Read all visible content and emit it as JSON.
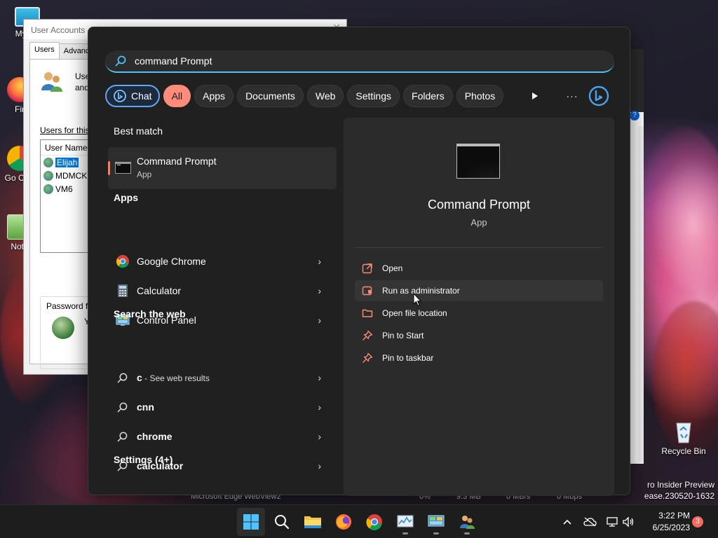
{
  "desktop": {
    "icons": [
      {
        "label": "My Co"
      },
      {
        "label": "Fir"
      },
      {
        "label": "Go Chr"
      },
      {
        "label": "Note"
      },
      {
        "label": "Recycle Bin"
      }
    ],
    "watermark_line1": "ro Insider Preview",
    "watermark_line2": "ease.230520-1632"
  },
  "user_accounts": {
    "title": "User Accounts",
    "tabs": [
      "Users",
      "Advanc"
    ],
    "desc_line1": "User",
    "desc_line2": "and",
    "users_for_label": "Users for this",
    "column_header": "User Name",
    "users": [
      "Elijah",
      "MDMCK",
      "VM6"
    ],
    "password_label": "Password fo",
    "password_text": "Y"
  },
  "background_window": {
    "help_label": "?",
    "strip": [
      "Microsoft Edge WebView2",
      "0%",
      "9.3 MB",
      "0 MB/s",
      "0 Mbps"
    ]
  },
  "search": {
    "query": "command Prompt",
    "filters": [
      "Chat",
      "All",
      "Apps",
      "Documents",
      "Web",
      "Settings",
      "Folders",
      "Photos"
    ],
    "active_filter": "All",
    "more_label": "···"
  },
  "results": {
    "best_match_heading": "Best match",
    "best_match": {
      "title": "Command Prompt",
      "subtitle": "App"
    },
    "apps_heading": "Apps",
    "apps": [
      {
        "label": "Google Chrome",
        "icon": "chrome-icon"
      },
      {
        "label": "Calculator",
        "icon": "calculator-icon"
      },
      {
        "label": "Control Panel",
        "icon": "control-panel-icon"
      }
    ],
    "web_heading": "Search the web",
    "web": [
      {
        "label_bold": "c",
        "label_rest": " - See web results"
      },
      {
        "label_bold": "cnn",
        "label_rest": ""
      },
      {
        "label_bold": "chrome",
        "label_rest": ""
      },
      {
        "label_bold": "calculator",
        "label_rest": ""
      }
    ],
    "settings_heading": "Settings (4+)"
  },
  "preview": {
    "title": "Command Prompt",
    "subtitle": "App",
    "actions": [
      {
        "label": "Open",
        "icon": "open-external-icon"
      },
      {
        "label": "Run as administrator",
        "icon": "admin-shield-icon"
      },
      {
        "label": "Open file location",
        "icon": "folder-icon"
      },
      {
        "label": "Pin to Start",
        "icon": "pin-icon"
      },
      {
        "label": "Pin to taskbar",
        "icon": "pin-icon"
      }
    ]
  },
  "taskbar": {
    "time": "3:22 PM",
    "date": "6/25/2023",
    "notifications": "3",
    "apps": [
      "start-icon",
      "search-icon",
      "file-explorer-icon",
      "firefox-icon",
      "chrome-icon",
      "task-manager-icon",
      "control-panel-icon",
      "user-accounts-icon"
    ]
  },
  "colors": {
    "accent_chip": "#ff8c7a",
    "search_underline": "#4cc2ff",
    "best_match_marker": "#ff7b5c",
    "menu_bg": "#202020",
    "preview_bg": "#2b2b2b"
  }
}
